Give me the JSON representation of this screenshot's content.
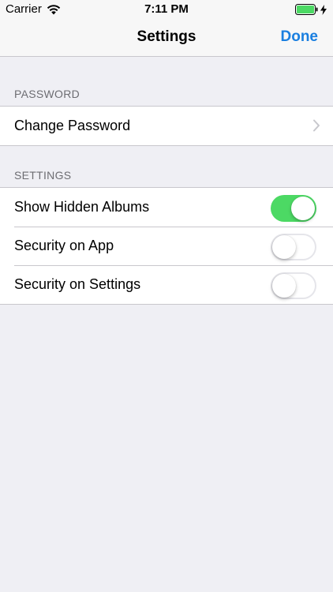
{
  "status_bar": {
    "carrier": "Carrier",
    "time": "7:11 PM",
    "battery_color": "#4cd964"
  },
  "nav": {
    "title": "Settings",
    "done_label": "Done",
    "accent_color": "#1a7fe0"
  },
  "sections": {
    "password": {
      "header": "PASSWORD",
      "rows": [
        {
          "label": "Change Password",
          "accessory": "chevron-right-icon"
        }
      ]
    },
    "settings": {
      "header": "SETTINGS",
      "rows": [
        {
          "label": "Show Hidden Albums",
          "toggle_on": true
        },
        {
          "label": "Security on App",
          "toggle_on": false
        },
        {
          "label": "Security on Settings",
          "toggle_on": false
        }
      ]
    }
  }
}
